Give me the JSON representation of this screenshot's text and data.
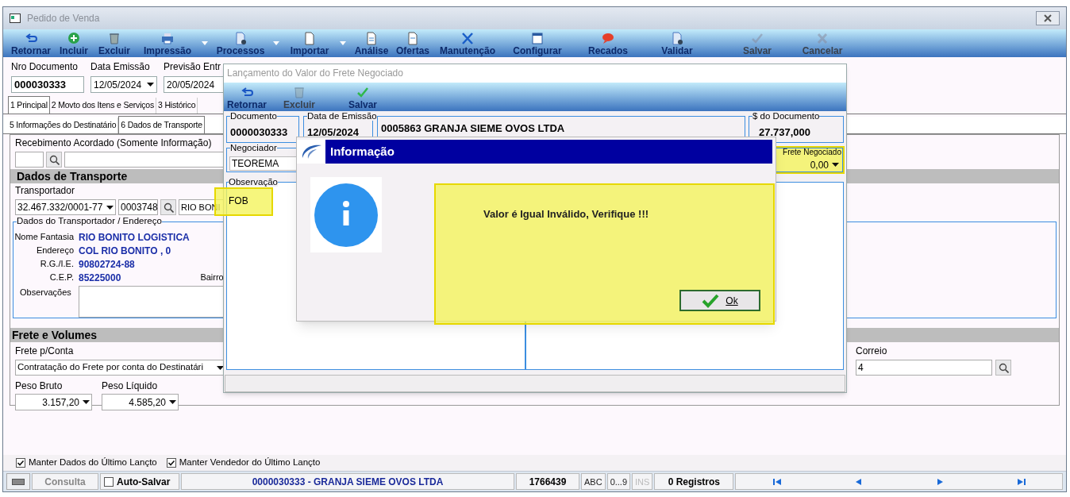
{
  "window": {
    "title": "Pedido de Venda"
  },
  "toolbar": [
    {
      "label": "Retornar",
      "disabled": false,
      "menu": false
    },
    {
      "label": "Incluir",
      "disabled": false,
      "menu": false
    },
    {
      "label": "Excluir",
      "disabled": false,
      "menu": false
    },
    {
      "label": "Impressão",
      "disabled": false,
      "menu": true
    },
    {
      "label": "Processos",
      "disabled": false,
      "menu": true
    },
    {
      "label": "Importar",
      "disabled": false,
      "menu": true
    },
    {
      "label": "Análise",
      "disabled": false,
      "menu": false
    },
    {
      "label": "Ofertas",
      "disabled": false,
      "menu": false
    },
    {
      "label": "Manutenção",
      "disabled": false,
      "menu": false
    },
    {
      "label": "Configurar",
      "disabled": false,
      "menu": false
    },
    {
      "label": "Recados",
      "disabled": false,
      "menu": false
    },
    {
      "label": "Validar",
      "disabled": false,
      "menu": false
    },
    {
      "label": "Salvar",
      "disabled": true,
      "menu": false
    },
    {
      "label": "Cancelar",
      "disabled": true,
      "menu": false
    }
  ],
  "header": [
    {
      "label": "Nro Documento",
      "value": "000030333",
      "kind": "text"
    },
    {
      "label": "Data Emissão",
      "value": "12/05/2024",
      "kind": "dropdown"
    },
    {
      "label": "Previsão Entr",
      "value": "20/05/2024",
      "kind": "text"
    }
  ],
  "tabs": [
    {
      "label": "1 Principal",
      "selected": true
    },
    {
      "label": "2 Movto dos Itens e Serviços",
      "selected": false
    },
    {
      "label": "3 Histórico",
      "selected": false
    }
  ],
  "subtabs": [
    {
      "label": "5 Informações do Destinatário",
      "selected": false
    },
    {
      "label": "6 Dados de Transporte",
      "selected": true
    }
  ],
  "recebimento": {
    "label": "Recebimento Acordado (Somente Informação)"
  },
  "transporte": {
    "heading": "Dados de Transporte",
    "label": "Transportador",
    "cnpj": "32.467.332/0001-77",
    "code": "0003748",
    "name": "RIO BONI"
  },
  "endereco": {
    "legend": "Dados do Transportador / Endereço",
    "rows": [
      {
        "label": "Nome Fantasia",
        "value": "RIO BONITO LOGISTICA"
      },
      {
        "label": "Endereço",
        "value": "COL RIO BONITO , 0"
      },
      {
        "label": "R.G./I.E.",
        "value": "90802724-88"
      },
      {
        "label": "C.E.P.",
        "value": "85225000"
      }
    ],
    "bairro_label": "Bairro",
    "obs_label": "Observações"
  },
  "frete": {
    "heading": "Frete e Volumes",
    "conta_label": "Frete p/Conta",
    "conta_value": "Contratação do Frete por conta do Destinatári",
    "peso_bruto": {
      "label": "Peso Bruto",
      "value": "3.157,20"
    },
    "peso_liquido": {
      "label": "Peso Líquido",
      "value": "4.585,20"
    },
    "correio": {
      "label": "Correio",
      "value": "4"
    }
  },
  "options": [
    {
      "label": "Manter Dados do Último Lançto",
      "checked": true
    },
    {
      "label": "Manter Vendedor do Último Lançto",
      "checked": true
    }
  ],
  "status_bar": {
    "mode": "Consulta",
    "auto_save": {
      "label": "Auto-Salvar",
      "checked": false
    },
    "record": "0000030333 - GRANJA SIEME OVOS LTDA",
    "code": "1766439",
    "indicators": [
      {
        "label": "ABC",
        "disabled": false
      },
      {
        "label": "0...9",
        "disabled": false
      },
      {
        "label": "INS",
        "disabled": true
      }
    ],
    "count": "0 Registros",
    "nav": [
      {
        "kind": "first"
      },
      {
        "kind": "prev"
      },
      {
        "kind": "next"
      },
      {
        "kind": "last"
      }
    ]
  },
  "freight_dialog": {
    "title": "Lançamento do Valor do Frete Negociado",
    "toolbar": [
      {
        "label": "Retornar",
        "disabled": false
      },
      {
        "label": "Excluir",
        "disabled": true
      },
      {
        "label": "Salvar",
        "disabled": false
      }
    ],
    "documento": {
      "label": "Documento",
      "value": "0000030333"
    },
    "data": {
      "label": "Data de Emissão",
      "value": "12/05/2024"
    },
    "cliente": "0005863 GRANJA SIEME OVOS LTDA",
    "valor_doc": {
      "label": "$ do Documento",
      "value": "27.737,000"
    },
    "negociador": {
      "label": "Negociador",
      "value": "TEOREMA"
    },
    "frete_negociado": {
      "label": "Frete Negociado",
      "value": "0,00",
      "highlighted": true
    },
    "observacao": {
      "label": "Observação",
      "value": "FOB",
      "highlighted": true
    }
  },
  "info_dialog": {
    "title": "Informação",
    "message": "Valor é Igual Inválido, Verifique !!!",
    "button": "Ok",
    "highlighted": true
  }
}
